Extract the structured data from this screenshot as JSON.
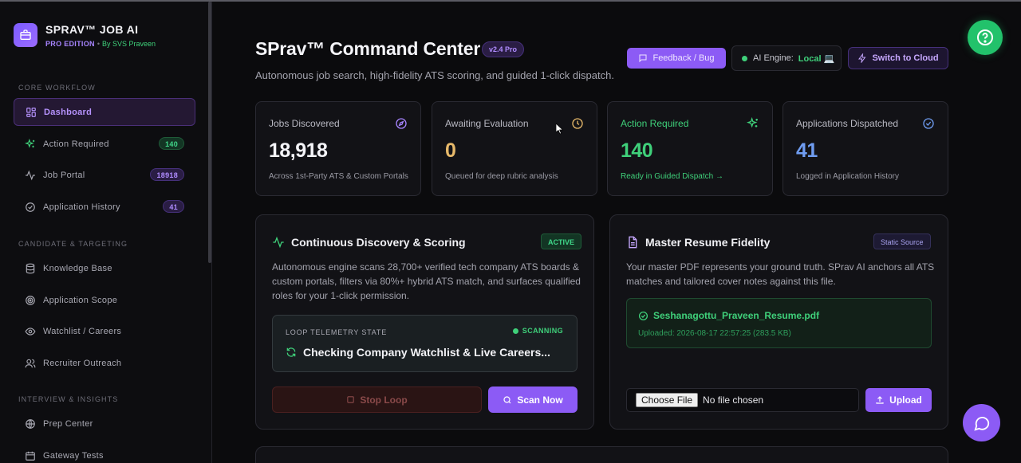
{
  "brand": {
    "title": "SPRAV™ JOB AI",
    "edition": "PRO EDITION",
    "separator": "•",
    "by": "By SVS Praveen"
  },
  "sidebar": {
    "sections": [
      {
        "label": "CORE WORKFLOW"
      },
      {
        "label": "CANDIDATE & TARGETING"
      },
      {
        "label": "INTERVIEW & INSIGHTS"
      }
    ],
    "items": [
      {
        "label": "Dashboard",
        "icon": "grid-icon",
        "active": true
      },
      {
        "label": "Action Required",
        "icon": "sparkle-icon",
        "badge": "140"
      },
      {
        "label": "Job Portal",
        "icon": "pulse-icon",
        "badge": "18918"
      },
      {
        "label": "Application History",
        "icon": "check-circle-icon",
        "badge": "41"
      },
      {
        "label": "Knowledge Base",
        "icon": "database-icon"
      },
      {
        "label": "Application Scope",
        "icon": "target-icon"
      },
      {
        "label": "Watchlist / Careers",
        "icon": "eye-icon"
      },
      {
        "label": "Recruiter Outreach",
        "icon": "users-icon"
      },
      {
        "label": "Prep Center",
        "icon": "globe-icon"
      },
      {
        "label": "Gateway Tests",
        "icon": "calendar-icon"
      }
    ]
  },
  "header": {
    "title": "SPrav™ Command Center",
    "version": "v2.4 Pro",
    "subtitle": "Autonomous job search, high-fidelity ATS scoring, and guided 1-click dispatch.",
    "feedback_label": "Feedback / Bug",
    "engine_label": "AI Engine:",
    "engine_value": "Local 💻",
    "cloud_label": "Switch to Cloud"
  },
  "stats": [
    {
      "label": "Jobs Discovered",
      "value": "18,918",
      "note": "Across 1st-Party ATS & Custom Portals",
      "icon": "compass-icon",
      "color": "#f4f4f8"
    },
    {
      "label": "Awaiting Evaluation",
      "value": "0",
      "note": "Queued for deep rubric analysis",
      "icon": "clock-icon",
      "color": "#e7b96a"
    },
    {
      "label": "Action Required",
      "value": "140",
      "note": "Ready in Guided Dispatch →",
      "icon": "sparkle-icon",
      "color": "#3fd07a"
    },
    {
      "label": "Applications Dispatched",
      "value": "41",
      "note": "Logged in Application History",
      "icon": "check-circle-icon",
      "color": "#6f9cf0"
    }
  ],
  "discovery": {
    "title": "Continuous Discovery & Scoring",
    "tag": "ACTIVE",
    "desc_lines": [
      "Autonomous engine scans 28,700+ verified tech company ATS boards &",
      "custom portals, filters via 80%+ hybrid ATS match, and surfaces qualified",
      "roles for your 1-click permission."
    ],
    "telemetry_label": "LOOP TELEMETRY STATE",
    "telemetry_state": "SCANNING",
    "telemetry_text": "Checking Company Watchlist & Live Careers...",
    "stop_label": "Stop Loop",
    "scan_label": "Scan Now"
  },
  "resume": {
    "title": "Master Resume Fidelity",
    "tag": "Static Source",
    "desc_lines": [
      "Your master PDF represents your ground truth. SPrav AI anchors all ATS",
      "matches and tailored cover notes against this file."
    ],
    "file_name": "Seshanagottu_Praveen_Resume.pdf",
    "file_meta": "Uploaded: 2026-08-17 22:57:25 (283.5 KB)",
    "choose_label": "Choose File",
    "no_file": "No file chosen",
    "upload_label": "Upload"
  }
}
